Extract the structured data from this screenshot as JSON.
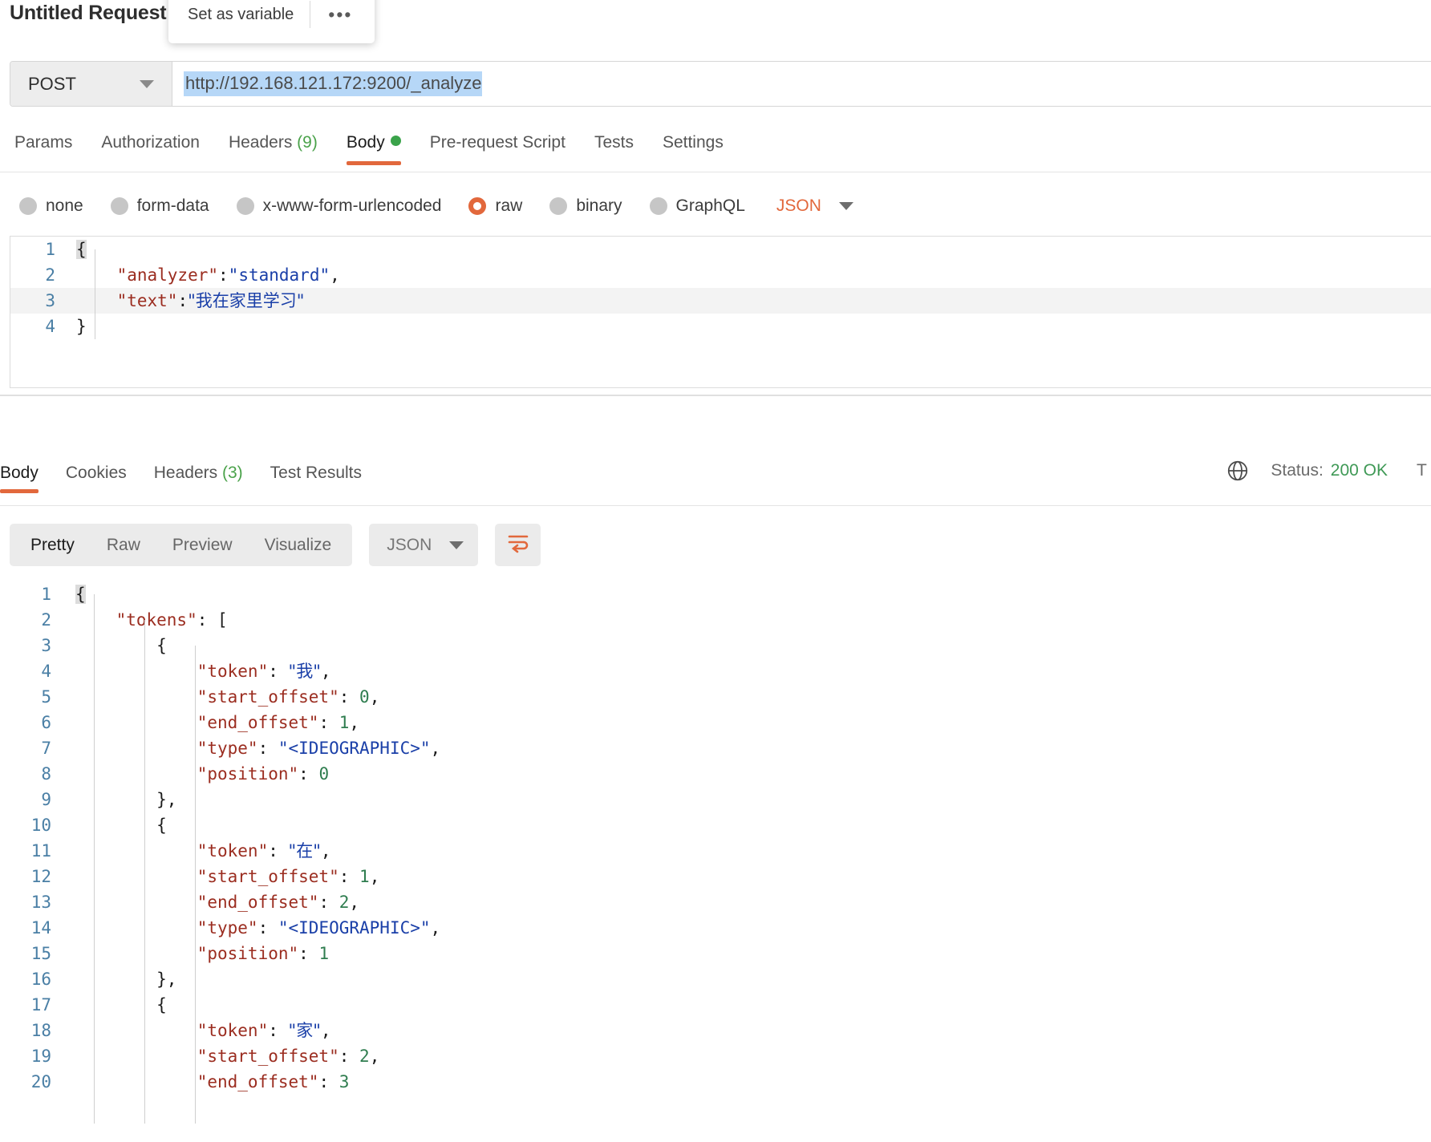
{
  "request": {
    "title": "Untitled Request",
    "popover": {
      "set_variable_label": "Set as variable",
      "more_label": "•••"
    },
    "method": "POST",
    "url": "http://192.168.121.172:9200/_analyze",
    "tabs": [
      {
        "label": "Params",
        "count": "",
        "active": false,
        "dot": false
      },
      {
        "label": "Authorization",
        "count": "",
        "active": false,
        "dot": false
      },
      {
        "label": "Headers",
        "count": "(9)",
        "active": false,
        "dot": false
      },
      {
        "label": "Body",
        "count": "",
        "active": true,
        "dot": true
      },
      {
        "label": "Pre-request Script",
        "count": "",
        "active": false,
        "dot": false
      },
      {
        "label": "Tests",
        "count": "",
        "active": false,
        "dot": false
      },
      {
        "label": "Settings",
        "count": "",
        "active": false,
        "dot": false
      }
    ],
    "body_types": [
      {
        "label": "none",
        "selected": false
      },
      {
        "label": "form-data",
        "selected": false
      },
      {
        "label": "x-www-form-urlencoded",
        "selected": false
      },
      {
        "label": "raw",
        "selected": true
      },
      {
        "label": "binary",
        "selected": false
      },
      {
        "label": "GraphQL",
        "selected": false
      }
    ],
    "format_selected": "JSON",
    "body_lines": [
      {
        "n": "1",
        "segments": [
          {
            "t": "{",
            "c": "pun",
            "hl": true
          }
        ]
      },
      {
        "n": "2",
        "segments": [
          {
            "t": "    ",
            "c": "pun"
          },
          {
            "t": "\"analyzer\"",
            "c": "key"
          },
          {
            "t": ":",
            "c": "pun"
          },
          {
            "t": "\"standard\"",
            "c": "str"
          },
          {
            "t": ",",
            "c": "pun"
          }
        ]
      },
      {
        "n": "3",
        "segments": [
          {
            "t": "    ",
            "c": "pun"
          },
          {
            "t": "\"text\"",
            "c": "key"
          },
          {
            "t": ":",
            "c": "pun"
          },
          {
            "t": "\"我在家里学习\"",
            "c": "str"
          }
        ]
      },
      {
        "n": "4",
        "segments": [
          {
            "t": "}",
            "c": "pun"
          }
        ]
      }
    ]
  },
  "response": {
    "tabs": [
      {
        "label": "Body",
        "count": "",
        "active": true
      },
      {
        "label": "Cookies",
        "count": "",
        "active": false
      },
      {
        "label": "Headers",
        "count": "(3)",
        "active": false
      },
      {
        "label": "Test Results",
        "count": "",
        "active": false
      }
    ],
    "status_label": "Status:",
    "status_value": "200 OK",
    "status_trailing": "T",
    "view_modes": [
      {
        "label": "Pretty",
        "active": true
      },
      {
        "label": "Raw",
        "active": false
      },
      {
        "label": "Preview",
        "active": false
      },
      {
        "label": "Visualize",
        "active": false
      }
    ],
    "format_selected": "JSON",
    "wrap_icon": "word-wrap-icon",
    "body_lines": [
      {
        "n": "1",
        "segments": [
          {
            "t": "{",
            "c": "pun",
            "hl": true
          }
        ]
      },
      {
        "n": "2",
        "segments": [
          {
            "t": "    ",
            "c": "pun"
          },
          {
            "t": "\"tokens\"",
            "c": "key"
          },
          {
            "t": ": [",
            "c": "pun"
          }
        ]
      },
      {
        "n": "3",
        "segments": [
          {
            "t": "        {",
            "c": "pun"
          }
        ]
      },
      {
        "n": "4",
        "segments": [
          {
            "t": "            ",
            "c": "pun"
          },
          {
            "t": "\"token\"",
            "c": "key"
          },
          {
            "t": ": ",
            "c": "pun"
          },
          {
            "t": "\"我\"",
            "c": "str"
          },
          {
            "t": ",",
            "c": "pun"
          }
        ]
      },
      {
        "n": "5",
        "segments": [
          {
            "t": "            ",
            "c": "pun"
          },
          {
            "t": "\"start_offset\"",
            "c": "key"
          },
          {
            "t": ": ",
            "c": "pun"
          },
          {
            "t": "0",
            "c": "num"
          },
          {
            "t": ",",
            "c": "pun"
          }
        ]
      },
      {
        "n": "6",
        "segments": [
          {
            "t": "            ",
            "c": "pun"
          },
          {
            "t": "\"end_offset\"",
            "c": "key"
          },
          {
            "t": ": ",
            "c": "pun"
          },
          {
            "t": "1",
            "c": "num"
          },
          {
            "t": ",",
            "c": "pun"
          }
        ]
      },
      {
        "n": "7",
        "segments": [
          {
            "t": "            ",
            "c": "pun"
          },
          {
            "t": "\"type\"",
            "c": "key"
          },
          {
            "t": ": ",
            "c": "pun"
          },
          {
            "t": "\"<IDEOGRAPHIC>\"",
            "c": "str"
          },
          {
            "t": ",",
            "c": "pun"
          }
        ]
      },
      {
        "n": "8",
        "segments": [
          {
            "t": "            ",
            "c": "pun"
          },
          {
            "t": "\"position\"",
            "c": "key"
          },
          {
            "t": ": ",
            "c": "pun"
          },
          {
            "t": "0",
            "c": "num"
          }
        ]
      },
      {
        "n": "9",
        "segments": [
          {
            "t": "        },",
            "c": "pun"
          }
        ]
      },
      {
        "n": "10",
        "segments": [
          {
            "t": "        {",
            "c": "pun"
          }
        ]
      },
      {
        "n": "11",
        "segments": [
          {
            "t": "            ",
            "c": "pun"
          },
          {
            "t": "\"token\"",
            "c": "key"
          },
          {
            "t": ": ",
            "c": "pun"
          },
          {
            "t": "\"在\"",
            "c": "str"
          },
          {
            "t": ",",
            "c": "pun"
          }
        ]
      },
      {
        "n": "12",
        "segments": [
          {
            "t": "            ",
            "c": "pun"
          },
          {
            "t": "\"start_offset\"",
            "c": "key"
          },
          {
            "t": ": ",
            "c": "pun"
          },
          {
            "t": "1",
            "c": "num"
          },
          {
            "t": ",",
            "c": "pun"
          }
        ]
      },
      {
        "n": "13",
        "segments": [
          {
            "t": "            ",
            "c": "pun"
          },
          {
            "t": "\"end_offset\"",
            "c": "key"
          },
          {
            "t": ": ",
            "c": "pun"
          },
          {
            "t": "2",
            "c": "num"
          },
          {
            "t": ",",
            "c": "pun"
          }
        ]
      },
      {
        "n": "14",
        "segments": [
          {
            "t": "            ",
            "c": "pun"
          },
          {
            "t": "\"type\"",
            "c": "key"
          },
          {
            "t": ": ",
            "c": "pun"
          },
          {
            "t": "\"<IDEOGRAPHIC>\"",
            "c": "str"
          },
          {
            "t": ",",
            "c": "pun"
          }
        ]
      },
      {
        "n": "15",
        "segments": [
          {
            "t": "            ",
            "c": "pun"
          },
          {
            "t": "\"position\"",
            "c": "key"
          },
          {
            "t": ": ",
            "c": "pun"
          },
          {
            "t": "1",
            "c": "num"
          }
        ]
      },
      {
        "n": "16",
        "segments": [
          {
            "t": "        },",
            "c": "pun"
          }
        ]
      },
      {
        "n": "17",
        "segments": [
          {
            "t": "        {",
            "c": "pun"
          }
        ]
      },
      {
        "n": "18",
        "segments": [
          {
            "t": "            ",
            "c": "pun"
          },
          {
            "t": "\"token\"",
            "c": "key"
          },
          {
            "t": ": ",
            "c": "pun"
          },
          {
            "t": "\"家\"",
            "c": "str"
          },
          {
            "t": ",",
            "c": "pun"
          }
        ]
      },
      {
        "n": "19",
        "segments": [
          {
            "t": "            ",
            "c": "pun"
          },
          {
            "t": "\"start_offset\"",
            "c": "key"
          },
          {
            "t": ": ",
            "c": "pun"
          },
          {
            "t": "2",
            "c": "num"
          },
          {
            "t": ",",
            "c": "pun"
          }
        ]
      },
      {
        "n": "20",
        "segments": [
          {
            "t": "            ",
            "c": "pun"
          },
          {
            "t": "\"end_offset\"",
            "c": "key"
          },
          {
            "t": ": ",
            "c": "pun"
          },
          {
            "t": "3",
            "c": "num"
          }
        ]
      }
    ]
  },
  "colors": {
    "accent": "#e2683c",
    "status_ok": "#3f9956",
    "json_key": "#9b2d20",
    "json_string": "#1a3fa8",
    "json_number": "#2f7d4f",
    "selection": "#b6d7f7"
  }
}
